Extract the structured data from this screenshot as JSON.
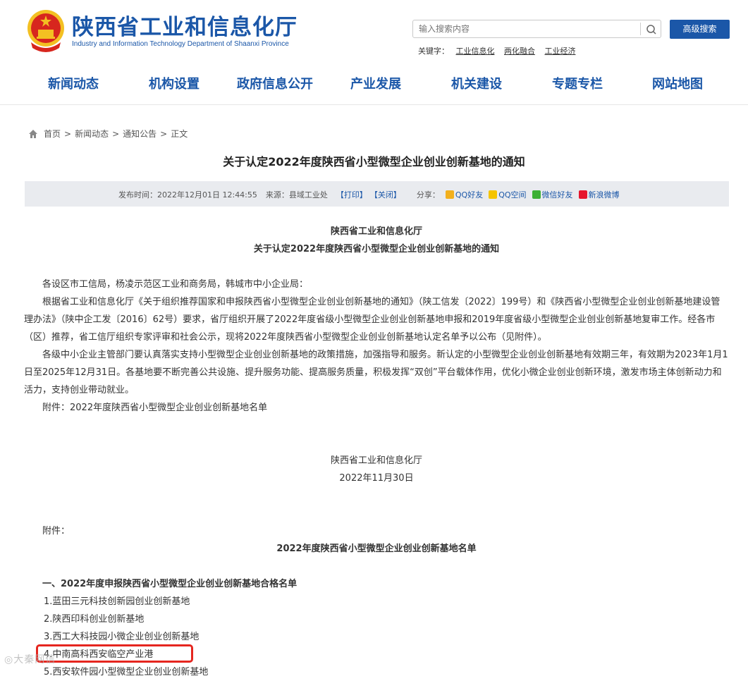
{
  "header": {
    "site_title": "陕西省工业和信息化厅",
    "site_subtitle": "Industry and Information Technology Department of Shaanxi Province",
    "search_placeholder": "输入搜索内容",
    "advanced_search_label": "高级搜索",
    "keywords_label": "关键字：",
    "keywords": [
      "工业信息化",
      "两化融合",
      "工业经济"
    ]
  },
  "nav": {
    "items": [
      "新闻动态",
      "机构设置",
      "政府信息公开",
      "产业发展",
      "机关建设",
      "专题专栏",
      "网站地图"
    ]
  },
  "breadcrumb": {
    "items": [
      "首页",
      "新闻动态",
      "通知公告",
      "正文"
    ],
    "separator": ">"
  },
  "article": {
    "title": "关于认定2022年度陕西省小型微型企业创业创新基地的通知",
    "meta": {
      "publish_label": "发布时间：",
      "publish_time": "2022年12月01日 12:44:55",
      "source_label": "来源：",
      "source": "县域工业处",
      "print": "【打印】",
      "close": "【关闭】",
      "share_label": "分享：",
      "share": [
        {
          "label": "QQ好友",
          "icon": "qq-icon",
          "color": "#f2b01e"
        },
        {
          "label": "QQ空间",
          "icon": "qzone-icon",
          "color": "#f5c400"
        },
        {
          "label": "微信好友",
          "icon": "wechat-icon",
          "color": "#3cb034"
        },
        {
          "label": "新浪微博",
          "icon": "weibo-icon",
          "color": "#e6162d"
        }
      ]
    },
    "body": {
      "org": "陕西省工业和信息化厅",
      "subtitle": "关于认定2022年度陕西省小型微型企业创业创新基地的通知",
      "salutation": "各设区市工信局，杨凌示范区工业和商务局，韩城市中小企业局：",
      "para1": "根据省工业和信息化厅《关于组织推荐国家和申报陕西省小型微型企业创业创新基地的通知》（陕工信发〔2022〕199号）和《陕西省小型微型企业创业创新基地建设管理办法》（陕中企工发〔2016〕62号）要求，省厅组织开展了2022年度省级小型微型企业创业创新基地申报和2019年度省级小型微型企业创业创新基地复审工作。经各市（区）推荐，省工信厅组织专家评审和社会公示，现将2022年度陕西省小型微型企业创业创新基地认定名单予以公布（见附件）。",
      "para2": "各级中小企业主管部门要认真落实支持小型微型企业创业创新基地的政策措施，加强指导和服务。新认定的小型微型企业创业创新基地有效期三年，有效期为2023年1月1日至2025年12月31日。各基地要不断完善公共设施、提升服务功能、提高服务质量，积极发挥“双创”平台载体作用，优化小微企业创业创新环境，激发市场主体创新动力和活力，支持创业带动就业。",
      "attachment_line": "附件：2022年度陕西省小型微型企业创业创新基地名单",
      "signature_org": "陕西省工业和信息化厅",
      "signature_date": "2022年11月30日",
      "attachment_label": "附件：",
      "list_title": "2022年度陕西省小型微型企业创业创新基地名单",
      "section1_title": "一、2022年度申报陕西省小型微型企业创业创新基地合格名单",
      "section1_items": [
        "1.蓝田三元科技创新园创业创新基地",
        "2.陕西印科创业创新基地",
        "3.西工大科技园小微企业创业创新基地",
        "4.中南高科西安临空产业港",
        "5.西安软件园小型微型企业创业创新基地"
      ]
    }
  },
  "watermark": "◎大秦网信",
  "colors": {
    "brand_blue": "#1b57a8",
    "meta_bar_bg": "#e9ebef",
    "highlight_red": "#e5261f"
  }
}
